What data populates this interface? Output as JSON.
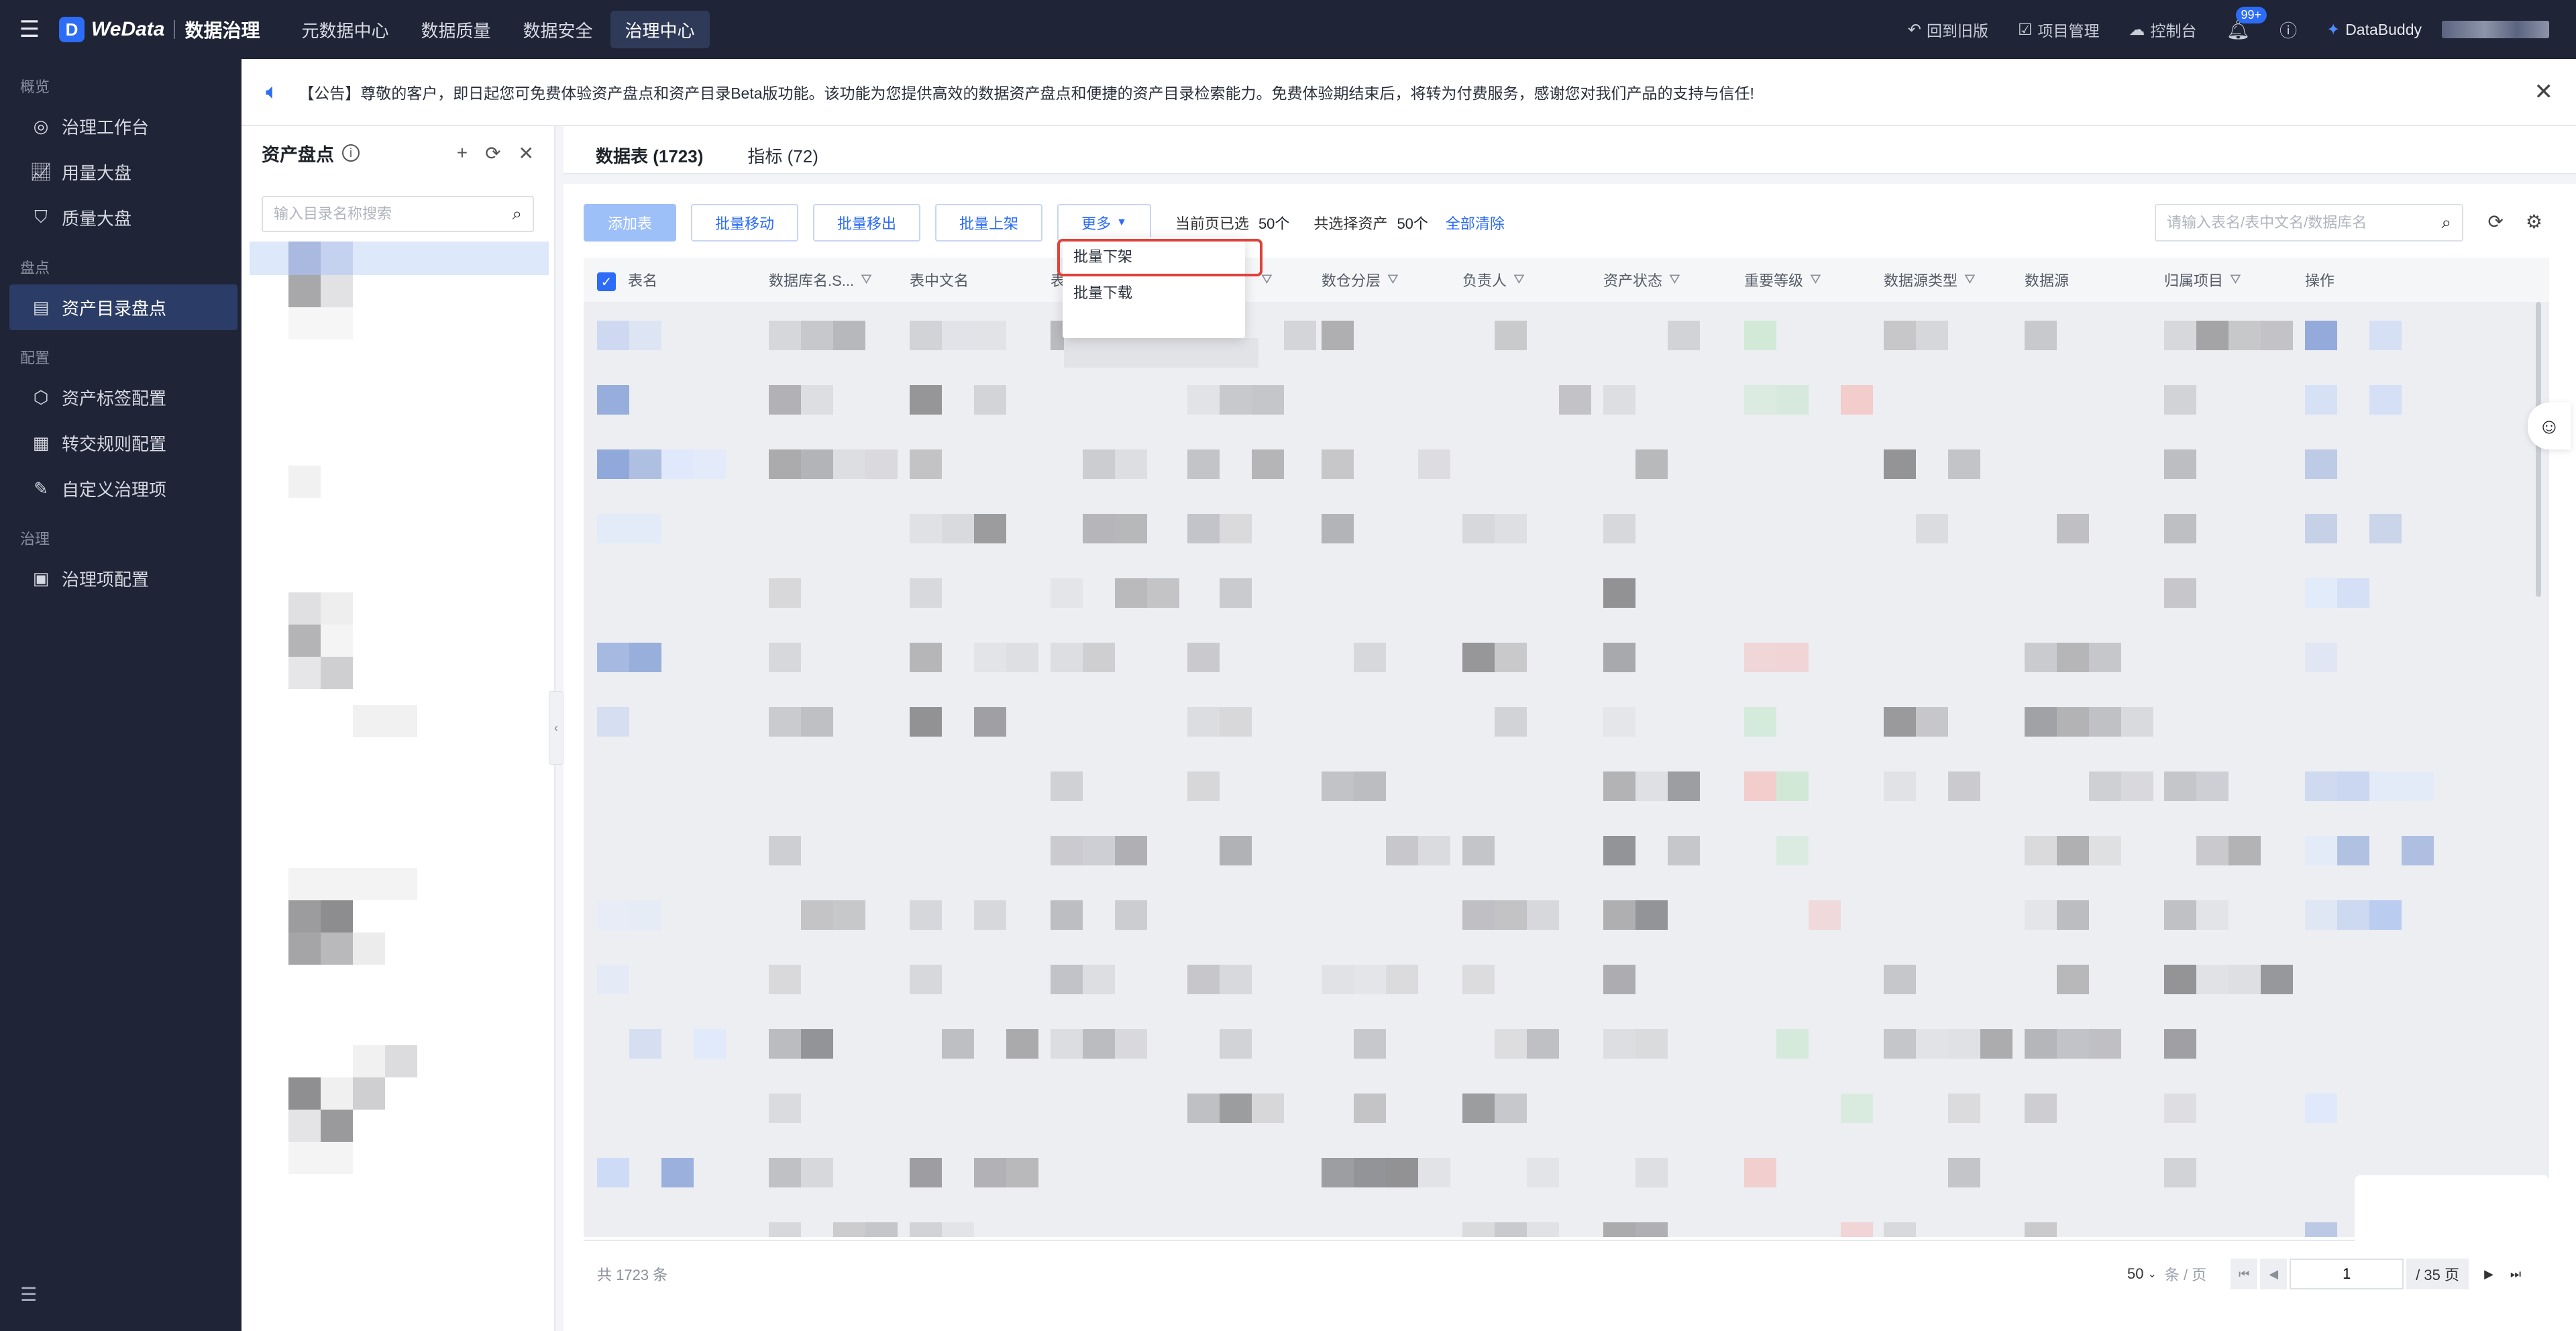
{
  "topbar": {
    "menu_icon": "menu-icon",
    "brand_name": "WeData",
    "brand_sub": "数据治理",
    "nav": [
      {
        "label": "元数据中心",
        "active": false
      },
      {
        "label": "数据质量",
        "active": false
      },
      {
        "label": "数据安全",
        "active": false
      },
      {
        "label": "治理中心",
        "active": true
      }
    ],
    "back_old": "回到旧版",
    "project_mgmt": "项目管理",
    "console": "控制台",
    "notify_badge": "99+",
    "assistant": "DataBuddy"
  },
  "sidebar": {
    "sections": [
      {
        "title": "概览",
        "items": [
          {
            "label": "治理工作台",
            "icon": "target-icon"
          },
          {
            "label": "用量大盘",
            "icon": "line-chart-icon"
          },
          {
            "label": "质量大盘",
            "icon": "shield-check-icon"
          }
        ]
      },
      {
        "title": "盘点",
        "items": [
          {
            "label": "资产目录盘点",
            "icon": "catalog-icon",
            "active": true
          }
        ]
      },
      {
        "title": "配置",
        "items": [
          {
            "label": "资产标签配置",
            "icon": "tag-icon"
          },
          {
            "label": "转交规则配置",
            "icon": "transfer-icon"
          },
          {
            "label": "自定义治理项",
            "icon": "edit-icon"
          }
        ]
      },
      {
        "title": "治理",
        "items": [
          {
            "label": "治理项配置",
            "icon": "grid-icon"
          }
        ]
      }
    ]
  },
  "notice": {
    "text": "【公告】尊敬的客户，即日起您可免费体验资产盘点和资产目录Beta版功能。该功能为您提供高效的数据资产盘点和便捷的资产目录检索能力。免费体验期结束后，将转为付费服务，感谢您对我们产品的支持与信任!"
  },
  "tree": {
    "title": "资产盘点",
    "search_placeholder": "输入目录名称搜索"
  },
  "tabs": [
    {
      "label": "数据表 (1723)",
      "active": true
    },
    {
      "label": "指标 (72)",
      "active": false
    }
  ],
  "toolbar": {
    "add": "添加表",
    "move": "批量移动",
    "remove": "批量移出",
    "publish": "批量上架",
    "more": "更多",
    "page_selected_label": "当前页已选",
    "page_selected_value": "50个",
    "total_selected_label": "共选择资产",
    "total_selected_value": "50个",
    "clear": "全部清除",
    "search_placeholder": "请输入表名/表中文名/数据库名"
  },
  "dropdown": {
    "items": [
      "批量下架",
      "批量下载"
    ]
  },
  "table": {
    "columns": [
      "表名",
      "数据库名.S...",
      "表中文名",
      "表",
      "",
      "数仓分层",
      "负责人",
      "资产状态",
      "重要等级",
      "数据源类型",
      "数据源",
      "归属项目",
      "操作"
    ]
  },
  "footer": {
    "total": "共 1723 条",
    "page_size": "50",
    "page_size_unit": "条 / 页",
    "current_page": "1",
    "total_pages": "/ 35 页"
  }
}
